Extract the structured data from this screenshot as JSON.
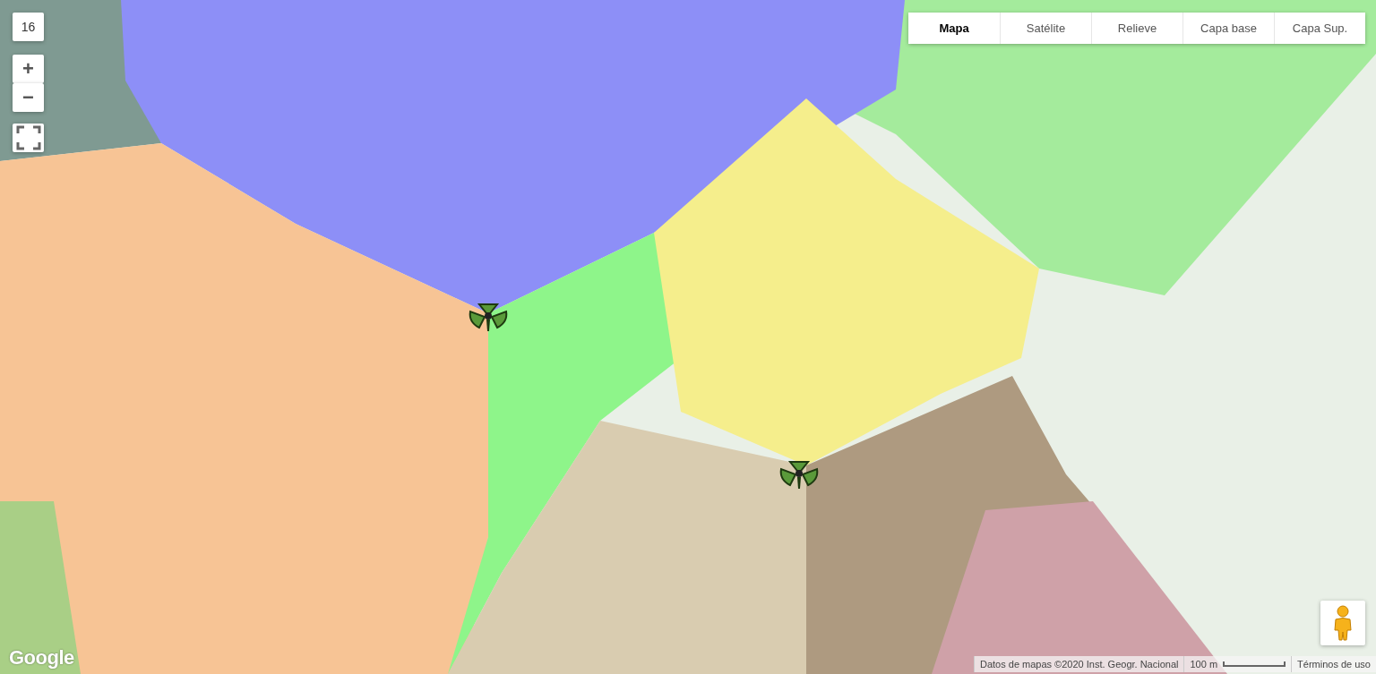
{
  "zoom_level": "16",
  "zoom_controls": {
    "zoom_in": "+",
    "zoom_out": "−"
  },
  "map_types": [
    {
      "label": "Mapa",
      "selected": true
    },
    {
      "label": "Satélite",
      "selected": false
    },
    {
      "label": "Relieve",
      "selected": false
    },
    {
      "label": "Capa base",
      "selected": false
    },
    {
      "label": "Capa Sup.",
      "selected": false
    }
  ],
  "logo": "Google",
  "footer": {
    "attribution": "Datos de mapas ©2020 Inst. Geogr. Nacional",
    "scale": "100 m",
    "terms": "Términos de uso"
  }
}
